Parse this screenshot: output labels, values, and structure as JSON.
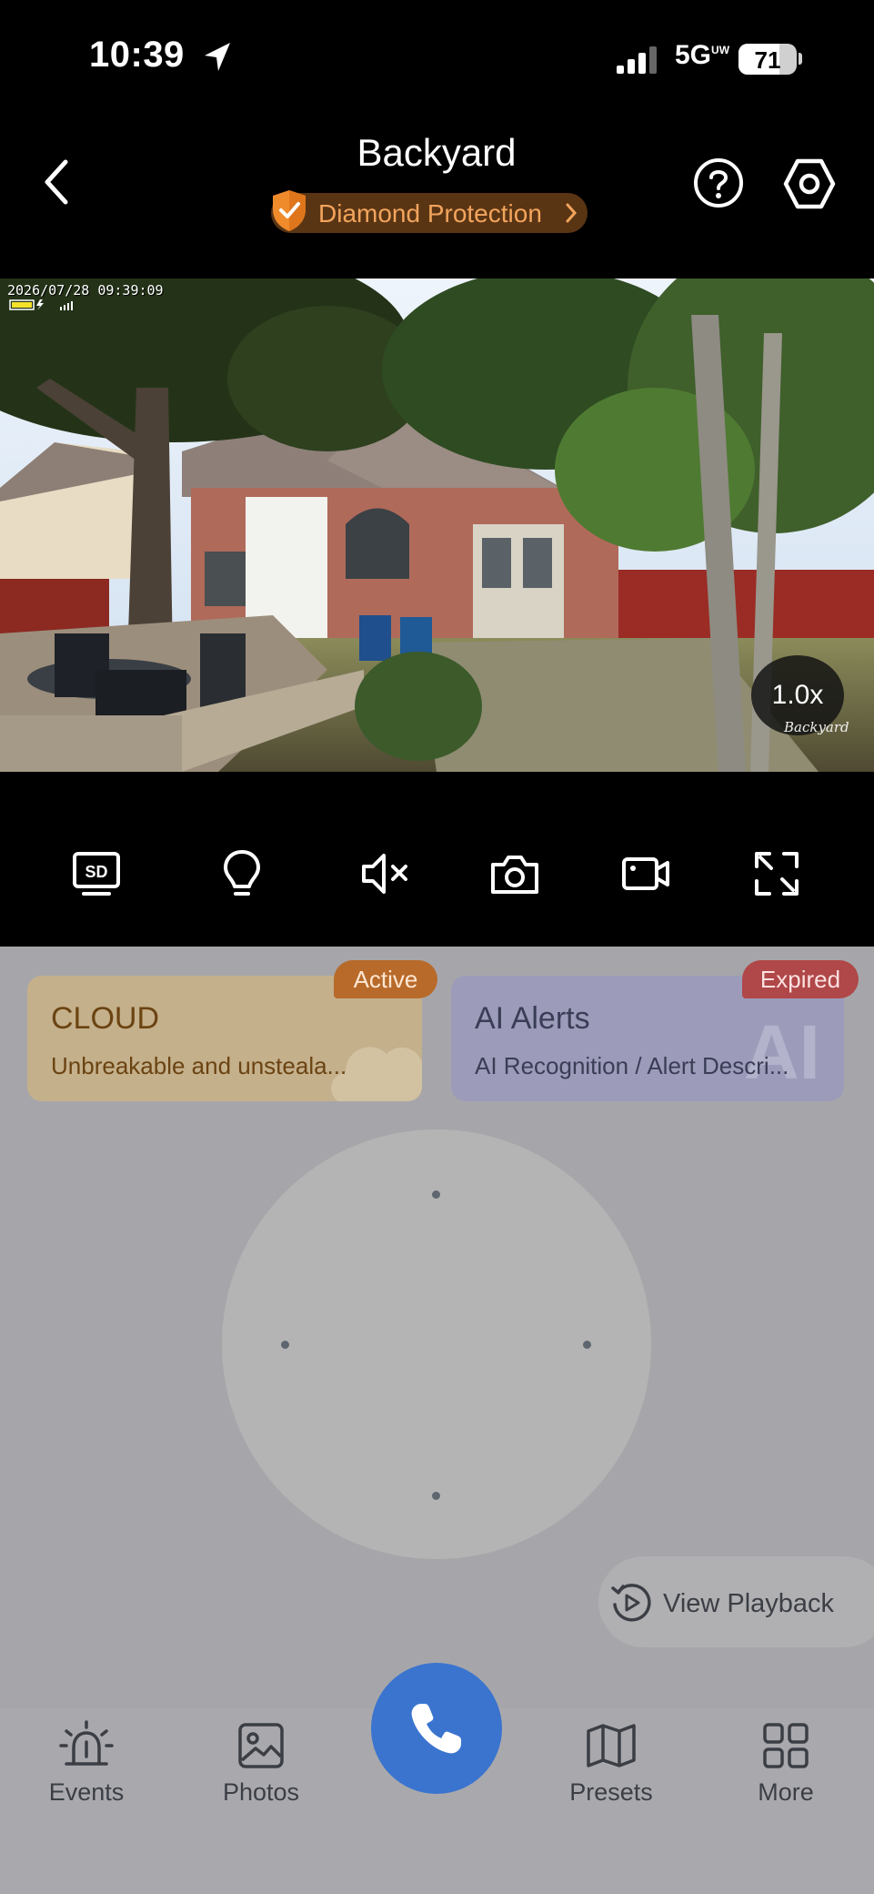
{
  "status_bar": {
    "time": "10:39",
    "network": "5G",
    "network_sup": "UW",
    "battery": "71",
    "battery_level": 0.71
  },
  "header": {
    "title": "Backyard",
    "protection_label": "Diamond Protection",
    "protection_color": "#f3a55d"
  },
  "video": {
    "timestamp": "2026/07/28 09:39:09",
    "zoom": "1.0x",
    "camera_name": "Backyard"
  },
  "toolbar": {
    "items": [
      {
        "icon": "sd-quality-icon"
      },
      {
        "icon": "light-bulb-icon"
      },
      {
        "icon": "mute-icon"
      },
      {
        "icon": "camera-icon"
      },
      {
        "icon": "video-record-icon"
      },
      {
        "icon": "fullscreen-icon"
      }
    ]
  },
  "cards": {
    "cloud": {
      "title": "CLOUD",
      "subtitle": "Unbreakable and unsteala...",
      "badge": "Active",
      "badge_color": "#b86a2a"
    },
    "ai": {
      "title": "AI Alerts",
      "subtitle": "AI Recognition / Alert Descri...",
      "badge": "Expired",
      "badge_color": "#b04748",
      "watermark": "AI"
    }
  },
  "playback": {
    "label": "View Playback"
  },
  "bottom_nav": {
    "events": "Events",
    "photos": "Photos",
    "presets": "Presets",
    "more": "More",
    "call_color": "#3a74cf"
  }
}
